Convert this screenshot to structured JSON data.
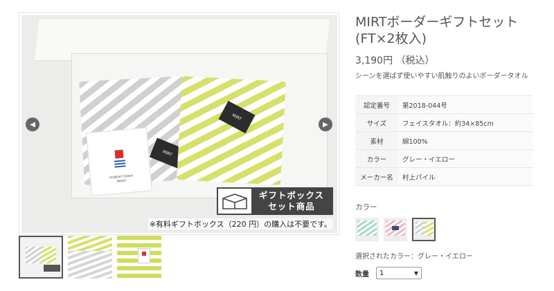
{
  "gallery": {
    "main_image_alt": "",
    "badge": {
      "line1": "ギフトボックス",
      "line2": "セット商品"
    },
    "note": "※有料ギフトボックス（220 円）の購入は不要です。",
    "tag_text": "imabari towel japan",
    "towel_label": "MIRT",
    "prev_icon": "chevron-left-icon",
    "next_icon": "chevron-right-icon",
    "thumbnails": [
      {
        "name": "thumb-giftbox",
        "active": true
      },
      {
        "name": "thumb-folded",
        "active": false
      },
      {
        "name": "thumb-closeup",
        "active": false
      }
    ]
  },
  "product": {
    "title": "MIRTボーダーギフトセット(FT×2枚入)",
    "price": "3,190円 （税込）",
    "catch": "シーンを選ばず使いやすい肌触りのよいボーダータオル",
    "specs": [
      {
        "key": "認定番号",
        "value": "第2018-044号"
      },
      {
        "key": "サイズ",
        "value": "フェイスタオル：約34×85cm"
      },
      {
        "key": "素材",
        "value": "綿100%"
      },
      {
        "key": "カラー",
        "value": "グレー・イエロー"
      },
      {
        "key": "メーカー名",
        "value": "村上パイル"
      }
    ]
  },
  "color": {
    "title": "カラー",
    "swatches": [
      {
        "name": "mint",
        "active": false,
        "color": "#a8d8cc"
      },
      {
        "name": "pink-navy",
        "active": false,
        "color": "#f0b8c4"
      },
      {
        "name": "grey-yellow",
        "active": true,
        "color": "#d6e06a"
      }
    ],
    "selected_text": "選択されたカラー：グレー・イエロー"
  },
  "quantity": {
    "label": "数量",
    "value": "1"
  },
  "colors": {
    "text": "#555555",
    "badge_bg": "#444444",
    "border": "#e6e6e6"
  }
}
